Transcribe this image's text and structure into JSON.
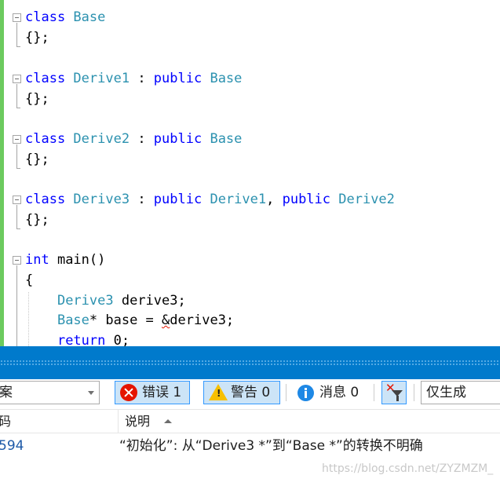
{
  "editor": {
    "lines": [
      {
        "parts": [
          {
            "t": "class ",
            "c": "kw"
          },
          {
            "t": "Base",
            "c": "ty"
          }
        ]
      },
      {
        "parts": [
          {
            "t": "{};",
            "c": ""
          }
        ]
      },
      {
        "parts": [
          {
            "t": "class ",
            "c": "kw"
          },
          {
            "t": "Derive1",
            "c": "ty"
          },
          {
            "t": " : ",
            "c": ""
          },
          {
            "t": "public ",
            "c": "kw"
          },
          {
            "t": "Base",
            "c": "ty"
          }
        ]
      },
      {
        "parts": [
          {
            "t": "{};",
            "c": ""
          }
        ]
      },
      {
        "parts": [
          {
            "t": "class ",
            "c": "kw"
          },
          {
            "t": "Derive2",
            "c": "ty"
          },
          {
            "t": " : ",
            "c": ""
          },
          {
            "t": "public ",
            "c": "kw"
          },
          {
            "t": "Base",
            "c": "ty"
          }
        ]
      },
      {
        "parts": [
          {
            "t": "{};",
            "c": ""
          }
        ]
      },
      {
        "parts": [
          {
            "t": "class ",
            "c": "kw"
          },
          {
            "t": "Derive3",
            "c": "ty"
          },
          {
            "t": " : ",
            "c": ""
          },
          {
            "t": "public ",
            "c": "kw"
          },
          {
            "t": "Derive1",
            "c": "ty"
          },
          {
            "t": ", ",
            "c": ""
          },
          {
            "t": "public ",
            "c": "kw"
          },
          {
            "t": "Derive2",
            "c": "ty"
          }
        ]
      },
      {
        "parts": [
          {
            "t": "{};",
            "c": ""
          }
        ]
      },
      {
        "parts": [
          {
            "t": "int",
            "c": "kw"
          },
          {
            "t": " main()",
            "c": ""
          }
        ]
      },
      {
        "parts": [
          {
            "t": "{",
            "c": ""
          }
        ]
      },
      {
        "parts": [
          {
            "t": "    ",
            "c": ""
          },
          {
            "t": "Derive3",
            "c": "ty"
          },
          {
            "t": " derive3;",
            "c": ""
          }
        ]
      },
      {
        "parts": [
          {
            "t": "    ",
            "c": ""
          },
          {
            "t": "Base",
            "c": "ty"
          },
          {
            "t": "* base = ",
            "c": ""
          },
          {
            "t": "&",
            "c": "squiggle"
          },
          {
            "t": "derive3;",
            "c": ""
          }
        ]
      },
      {
        "parts": [
          {
            "t": "    ",
            "c": ""
          },
          {
            "t": "return",
            "c": "kw"
          },
          {
            "t": " 0;",
            "c": ""
          }
        ]
      }
    ]
  },
  "error_list": {
    "scope": "案",
    "errors_label": "错误 1",
    "warnings_label": "警告 0",
    "messages_label": "消息 0",
    "build_filter": "仅生成",
    "columns": {
      "code": "码",
      "description": "说明"
    },
    "rows": [
      {
        "code": "594",
        "description": "“初始化”: 从“Derive3 *”到“Base *”的转换不明确"
      }
    ]
  },
  "icons": {
    "error": "error-circle-icon",
    "warning": "warning-triangle-icon",
    "info": "info-circle-icon",
    "clear_filter": "clear-filter-icon"
  },
  "colors": {
    "keyword": "#0000ff",
    "type": "#2b91af",
    "change_bar": "#6ccb5f",
    "panel_accent": "#007acc",
    "error": "#e51400",
    "warning": "#f7c000"
  },
  "watermark": "https://blog.csdn.net/ZYZMZM_"
}
